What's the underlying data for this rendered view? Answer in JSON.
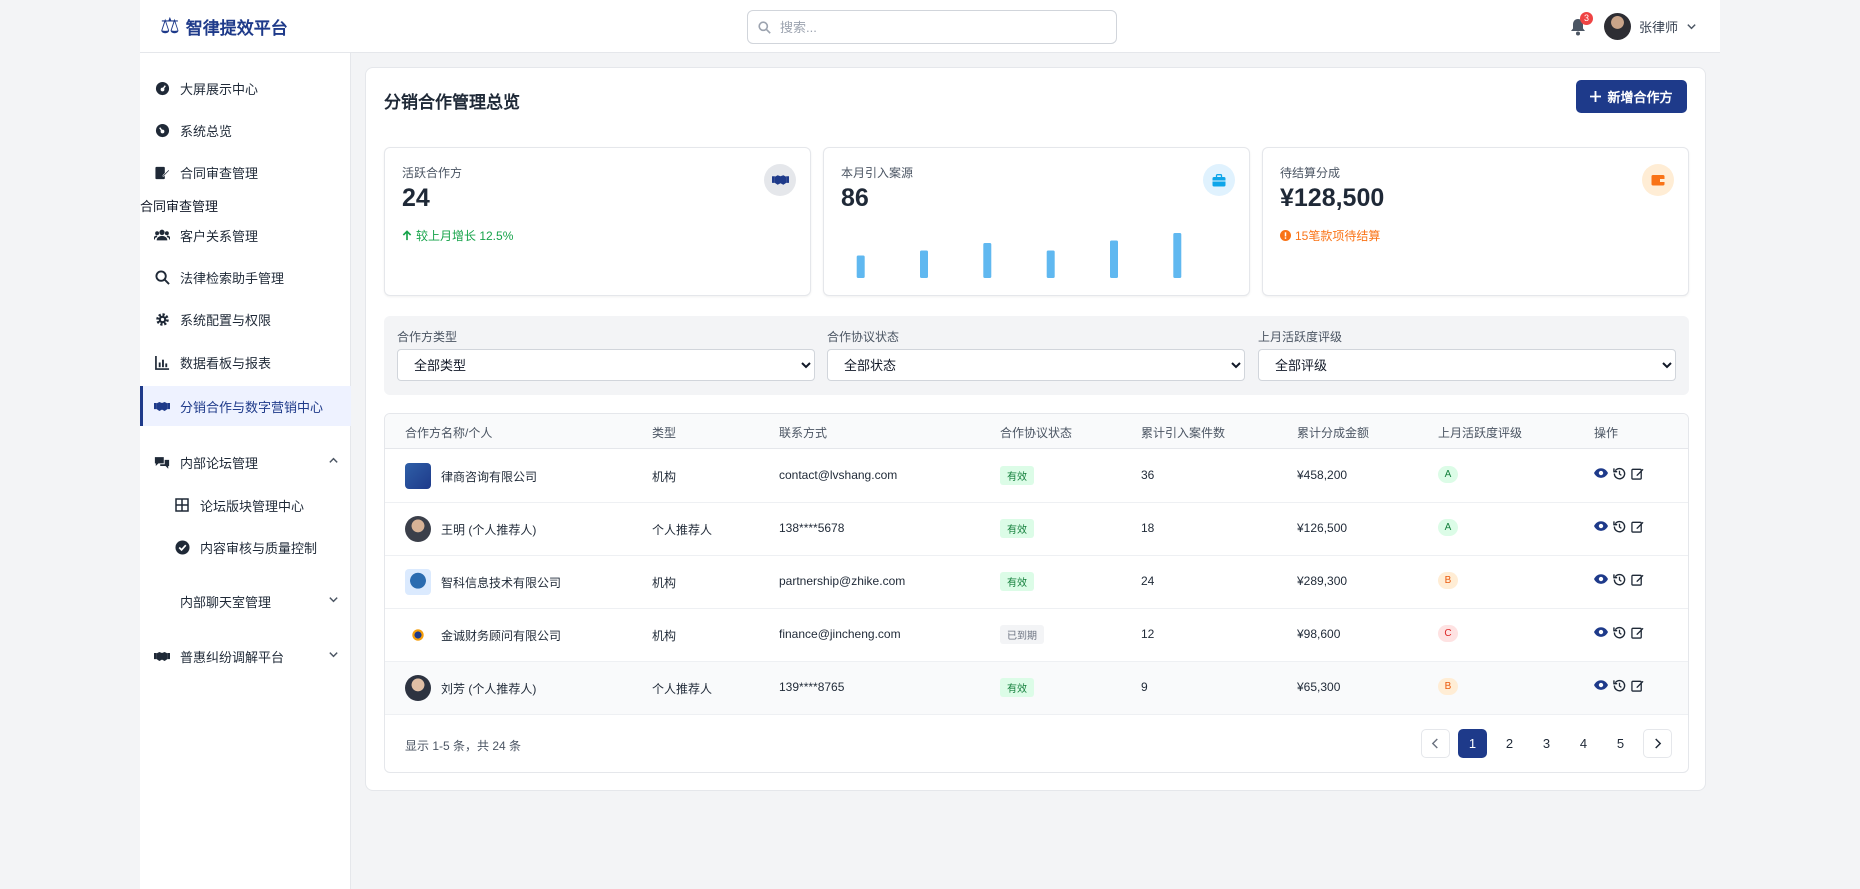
{
  "app": {
    "logo_glyph": "⚖",
    "name": "智律提效平台"
  },
  "search": {
    "placeholder": "搜索..."
  },
  "notifications": {
    "count": "3"
  },
  "user": {
    "name": "张律师"
  },
  "sidebar": {
    "items": [
      {
        "label": "大屏展示中心",
        "icon": "dashboard-icon"
      },
      {
        "label": "系统总览",
        "icon": "gauge-icon"
      },
      {
        "label": "合同审查管理",
        "icon": "contract-edit-icon"
      },
      {
        "label": "客户关系管理",
        "icon": "users-icon"
      },
      {
        "label": "法律检索助手管理",
        "icon": "search-icon"
      },
      {
        "label": "系统配置与权限",
        "icon": "gear-icon"
      },
      {
        "label": "数据看板与报表",
        "icon": "bar-chart-icon"
      },
      {
        "label": "分销合作与数字营销中心",
        "icon": "handshake-icon",
        "active": true
      },
      {
        "label": "内部论坛管理",
        "icon": "comments-icon",
        "expanded": true
      },
      {
        "label": "论坛版块管理中心",
        "icon": "grid-icon"
      },
      {
        "label": "内容审核与质量控制",
        "icon": "check-circle-icon"
      },
      {
        "label": "内部聊天室管理",
        "icon": ""
      },
      {
        "label": "普惠纠纷调解平台",
        "icon": "handshake-icon"
      }
    ],
    "stray_label": "合同审查管理"
  },
  "page": {
    "title": "分销合作管理总览",
    "add_button": "新增合作方"
  },
  "cards": [
    {
      "label": "活跃合作方",
      "value": "24",
      "sub": "较上月增长 12.5%",
      "icon": "handshake-icon",
      "accent": "#16a34a"
    },
    {
      "label": "本月引入案源",
      "value": "86",
      "icon": "briefcase-icon",
      "accent": "#0ea5e9"
    },
    {
      "label": "待结算分成",
      "value": "¥128,500",
      "sub": "15笔款项待结算",
      "icon": "wallet-icon",
      "accent": "#f97316"
    }
  ],
  "chart_data": {
    "type": "bar",
    "title": "",
    "categories": [
      "",
      "",
      "",
      "",
      "",
      ""
    ],
    "values": [
      9,
      11,
      14,
      11,
      15,
      18
    ],
    "ylim": [
      0,
      20
    ],
    "color": "#60b8f0"
  },
  "filters": [
    {
      "label": "合作方类型",
      "selected": "全部类型"
    },
    {
      "label": "合作协议状态",
      "selected": "全部状态"
    },
    {
      "label": "上月活跃度评级",
      "selected": "全部评级"
    }
  ],
  "table": {
    "columns": [
      "合作方名称/个人",
      "类型",
      "联系方式",
      "合作协议状态",
      "累计引入案件数",
      "累计分成金额",
      "上月活跃度评级",
      "操作"
    ],
    "rows": [
      {
        "name": "律商咨询有限公司",
        "type": "机构",
        "contact": "contact@lvshang.com",
        "status": "有效",
        "status_kind": "ok",
        "cases": "36",
        "amount": "¥458,200",
        "grade": "A"
      },
      {
        "name": "王明 (个人推荐人)",
        "type": "个人推荐人",
        "contact": "138****5678",
        "status": "有效",
        "status_kind": "ok",
        "cases": "18",
        "amount": "¥126,500",
        "grade": "A"
      },
      {
        "name": "智科信息技术有限公司",
        "type": "机构",
        "contact": "partnership@zhike.com",
        "status": "有效",
        "status_kind": "ok",
        "cases": "24",
        "amount": "¥289,300",
        "grade": "B"
      },
      {
        "name": "金诚财务顾问有限公司",
        "type": "机构",
        "contact": "finance@jincheng.com",
        "status": "已到期",
        "status_kind": "exp",
        "cases": "12",
        "amount": "¥98,600",
        "grade": "C"
      },
      {
        "name": "刘芳 (个人推荐人)",
        "type": "个人推荐人",
        "contact": "139****8765",
        "status": "有效",
        "status_kind": "ok",
        "cases": "9",
        "amount": "¥65,300",
        "grade": "B"
      }
    ],
    "footer": "显示 1-5 条，共 24 条"
  },
  "pagination": {
    "pages": [
      "1",
      "2",
      "3",
      "4",
      "5"
    ],
    "current": "1"
  },
  "colors": {
    "brand": "#1e3a8a",
    "gradeA": "#dcfce7",
    "gradeB": "#ffedd5",
    "gradeC": "#fee2e2"
  }
}
